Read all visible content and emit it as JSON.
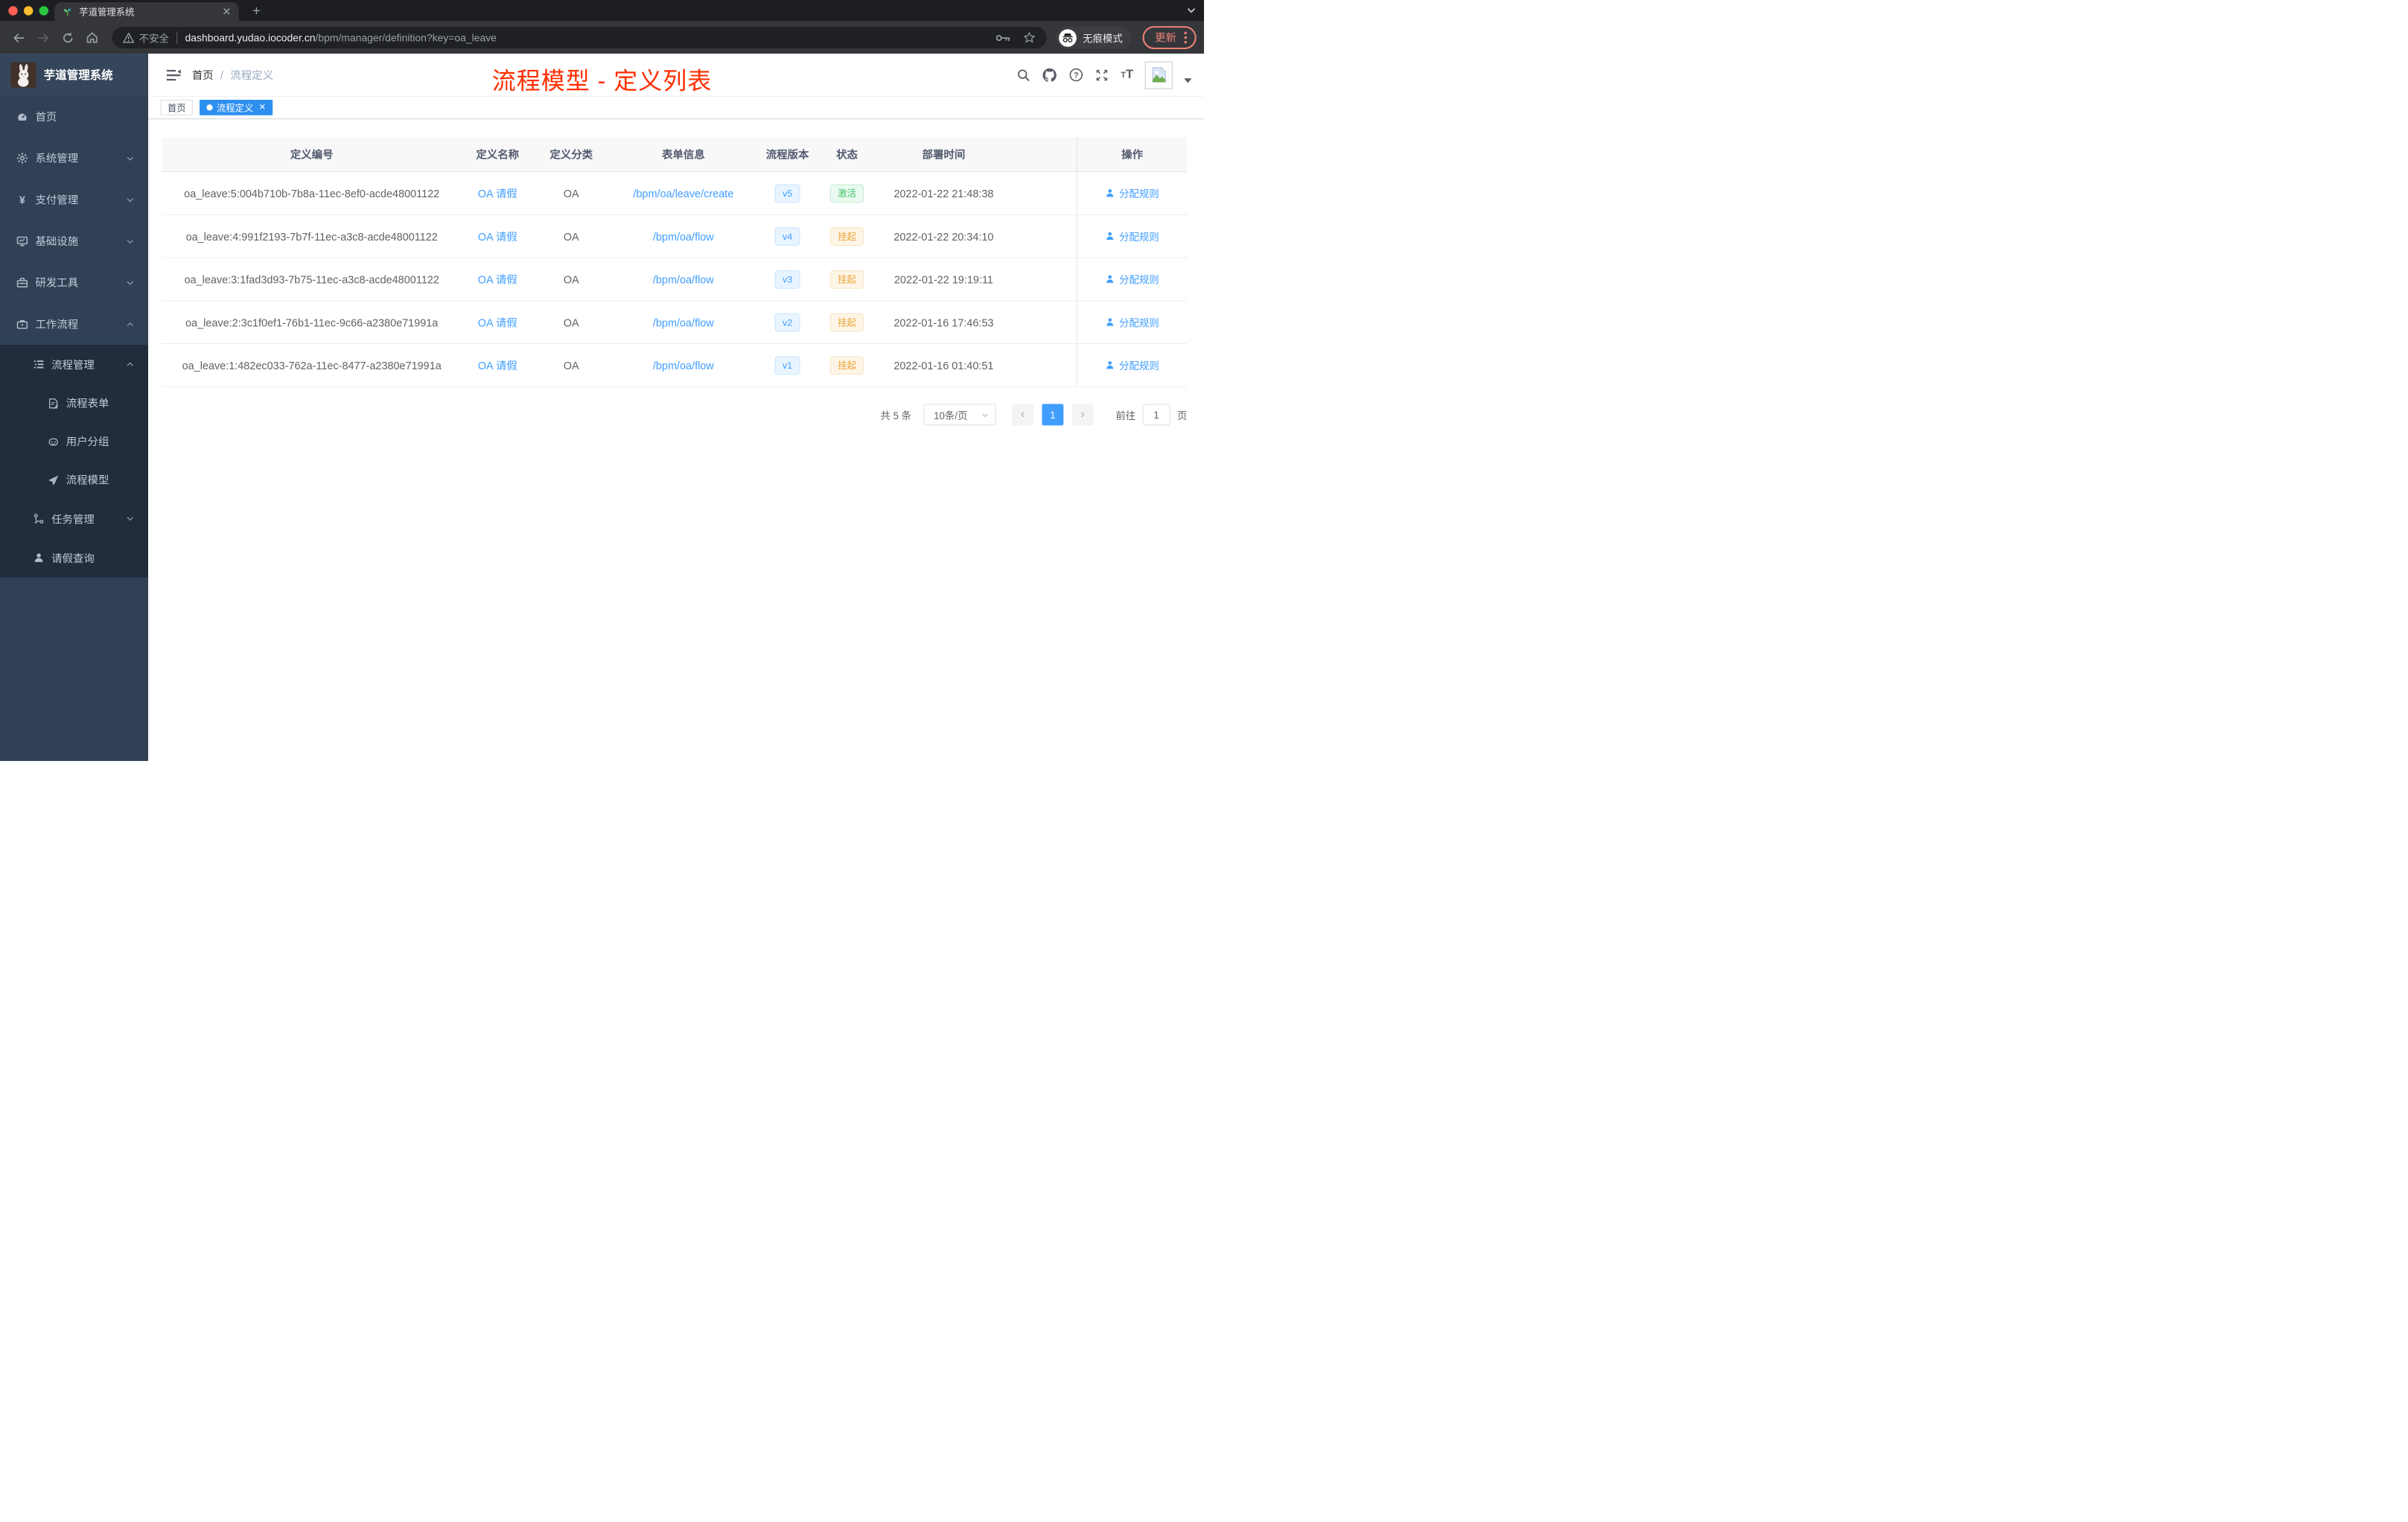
{
  "browser": {
    "tab_title": "芋道管理系统",
    "security_label": "不安全",
    "url_domain": "dashboard.yudao.iocoder.cn",
    "url_path": "/bpm/manager/definition?key=oa_leave",
    "incognito_label": "无痕模式",
    "update_label": "更新"
  },
  "header": {
    "logo_title": "芋道管理系统",
    "breadcrumb": {
      "home": "首页",
      "separator": "/",
      "current": "流程定义"
    },
    "annotation": "流程模型 - 定义列表"
  },
  "sidebar": {
    "items": [
      {
        "label": "首页",
        "icon": "dashboard-icon"
      },
      {
        "label": "系统管理",
        "icon": "gear-icon",
        "chevron": "down"
      },
      {
        "label": "支付管理",
        "icon": "yen-icon",
        "chevron": "down"
      },
      {
        "label": "基础设施",
        "icon": "monitor-icon",
        "chevron": "down"
      },
      {
        "label": "研发工具",
        "icon": "toolbox-icon",
        "chevron": "down"
      },
      {
        "label": "工作流程",
        "icon": "briefcase-icon",
        "chevron": "up"
      }
    ],
    "submenu": [
      {
        "label": "流程管理",
        "icon": "list-icon",
        "level": 2,
        "chevron": "up"
      },
      {
        "label": "流程表单",
        "icon": "form-icon",
        "level": 3
      },
      {
        "label": "用户分组",
        "icon": "robot-icon",
        "level": 3
      },
      {
        "label": "流程模型",
        "icon": "paper-plane-icon",
        "level": 3
      },
      {
        "label": "任务管理",
        "icon": "branch-icon",
        "level": 2,
        "chevron": "down"
      },
      {
        "label": "请假查询",
        "icon": "user-icon",
        "level": 2
      }
    ]
  },
  "tags": [
    {
      "label": "首页",
      "active": false,
      "closable": false
    },
    {
      "label": "流程定义",
      "active": true,
      "closable": true
    }
  ],
  "table": {
    "columns": [
      "定义编号",
      "定义名称",
      "定义分类",
      "表单信息",
      "流程版本",
      "状态",
      "部署时间",
      "操作"
    ],
    "rows": [
      {
        "id": "oa_leave:5:004b710b-7b8a-11ec-8ef0-acde48001122",
        "name": "OA 请假",
        "category": "OA",
        "form": "/bpm/oa/leave/create",
        "version": "v5",
        "status": "激活",
        "status_type": "success",
        "deploy_time": "2022-01-22 21:48:38",
        "action": "分配规则"
      },
      {
        "id": "oa_leave:4:991f2193-7b7f-11ec-a3c8-acde48001122",
        "name": "OA 请假",
        "category": "OA",
        "form": "/bpm/oa/flow",
        "version": "v4",
        "status": "挂起",
        "status_type": "warning",
        "deploy_time": "2022-01-22 20:34:10",
        "action": "分配规则"
      },
      {
        "id": "oa_leave:3:1fad3d93-7b75-11ec-a3c8-acde48001122",
        "name": "OA 请假",
        "category": "OA",
        "form": "/bpm/oa/flow",
        "version": "v3",
        "status": "挂起",
        "status_type": "warning",
        "deploy_time": "2022-01-22 19:19:11",
        "action": "分配规则"
      },
      {
        "id": "oa_leave:2:3c1f0ef1-76b1-11ec-9c66-a2380e71991a",
        "name": "OA 请假",
        "category": "OA",
        "form": "/bpm/oa/flow",
        "version": "v2",
        "status": "挂起",
        "status_type": "warning",
        "deploy_time": "2022-01-16 17:46:53",
        "action": "分配规则"
      },
      {
        "id": "oa_leave:1:482ec033-762a-11ec-8477-a2380e71991a",
        "name": "OA 请假",
        "category": "OA",
        "form": "/bpm/oa/flow",
        "version": "v1",
        "status": "挂起",
        "status_type": "warning",
        "deploy_time": "2022-01-16 01:40:51",
        "action": "分配规则"
      }
    ]
  },
  "pagination": {
    "total": "共 5 条",
    "page_size": "10条/页",
    "prev": "‹",
    "current_page": "1",
    "next": "›",
    "goto_label": "前往",
    "goto_value": "1",
    "unit": "页"
  },
  "colors": {
    "accent": "#409eff",
    "tag_active": "#2d8ff0",
    "status_active_text": "#41c468",
    "status_suspend_text": "#eca335",
    "annotation": "#ff2e00",
    "sidebar_bg": "#304156",
    "submenu_bg": "#212c3d",
    "update_button": "#ee8277"
  }
}
